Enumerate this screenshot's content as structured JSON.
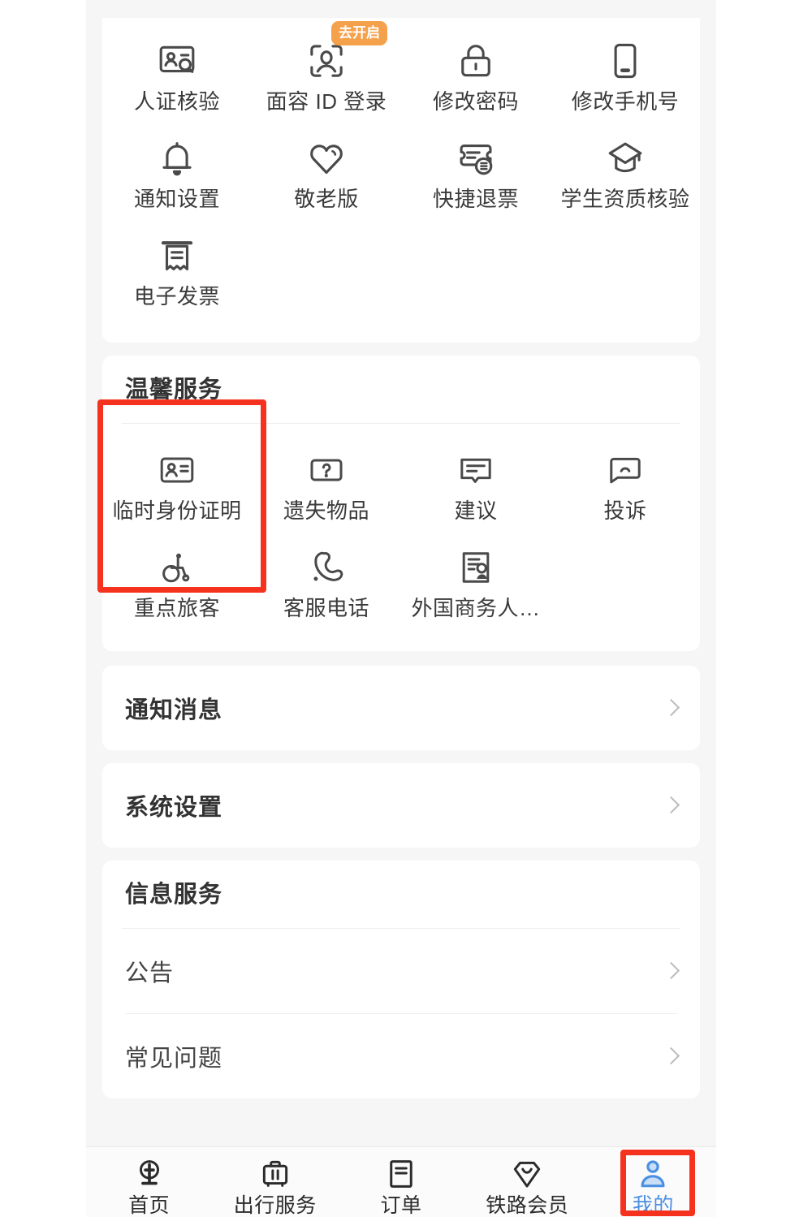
{
  "app": {
    "background_color": "#f6f6f6",
    "card_color": "#ffffff",
    "accent_orange": "#f5a04a",
    "accent_blue": "#4a90e2",
    "highlight_red": "#f5321e"
  },
  "account_section": {
    "tiles": [
      {
        "label": "人证核验",
        "icon": "id-card-verify-icon",
        "badge": null
      },
      {
        "label": "面容 ID 登录",
        "icon": "face-id-icon",
        "badge": "去开启"
      },
      {
        "label": "修改密码",
        "icon": "lock-icon",
        "badge": null
      },
      {
        "label": "修改手机号",
        "icon": "phone-icon",
        "badge": null
      },
      {
        "label": "通知设置",
        "icon": "bell-icon",
        "badge": null
      },
      {
        "label": "敬老版",
        "icon": "heart-icon",
        "badge": null
      },
      {
        "label": "快捷退票",
        "icon": "ticket-refund-icon",
        "badge": null
      },
      {
        "label": "学生资质核验",
        "icon": "graduation-cap-icon",
        "badge": null
      },
      {
        "label": "电子发票",
        "icon": "receipt-icon",
        "badge": null
      }
    ]
  },
  "warm_service_section": {
    "title": "温馨服务",
    "tiles": [
      {
        "label": "临时身份证明",
        "icon": "temp-id-card-icon"
      },
      {
        "label": "遗失物品",
        "icon": "question-box-icon"
      },
      {
        "label": "建议",
        "icon": "suggestion-bubble-icon"
      },
      {
        "label": "投诉",
        "icon": "complaint-bubble-icon"
      },
      {
        "label": "重点旅客",
        "icon": "wheelchair-icon"
      },
      {
        "label": "客服电话",
        "icon": "phone-call-icon"
      },
      {
        "label": "外国商务人…",
        "icon": "foreign-business-doc-icon"
      }
    ]
  },
  "notification_row": {
    "label": "通知消息"
  },
  "system_settings_row": {
    "label": "系统设置"
  },
  "info_service_section": {
    "title": "信息服务",
    "rows": [
      {
        "label": "公告"
      },
      {
        "label": "常见问题"
      }
    ]
  },
  "tabbar": {
    "tabs": [
      {
        "label": "首页",
        "icon": "railway-logo-icon",
        "active": false
      },
      {
        "label": "出行服务",
        "icon": "suitcase-icon",
        "active": false
      },
      {
        "label": "订单",
        "icon": "order-document-icon",
        "active": false
      },
      {
        "label": "铁路会员",
        "icon": "member-diamond-icon",
        "active": false
      },
      {
        "label": "我的",
        "icon": "person-icon",
        "active": true
      }
    ]
  }
}
